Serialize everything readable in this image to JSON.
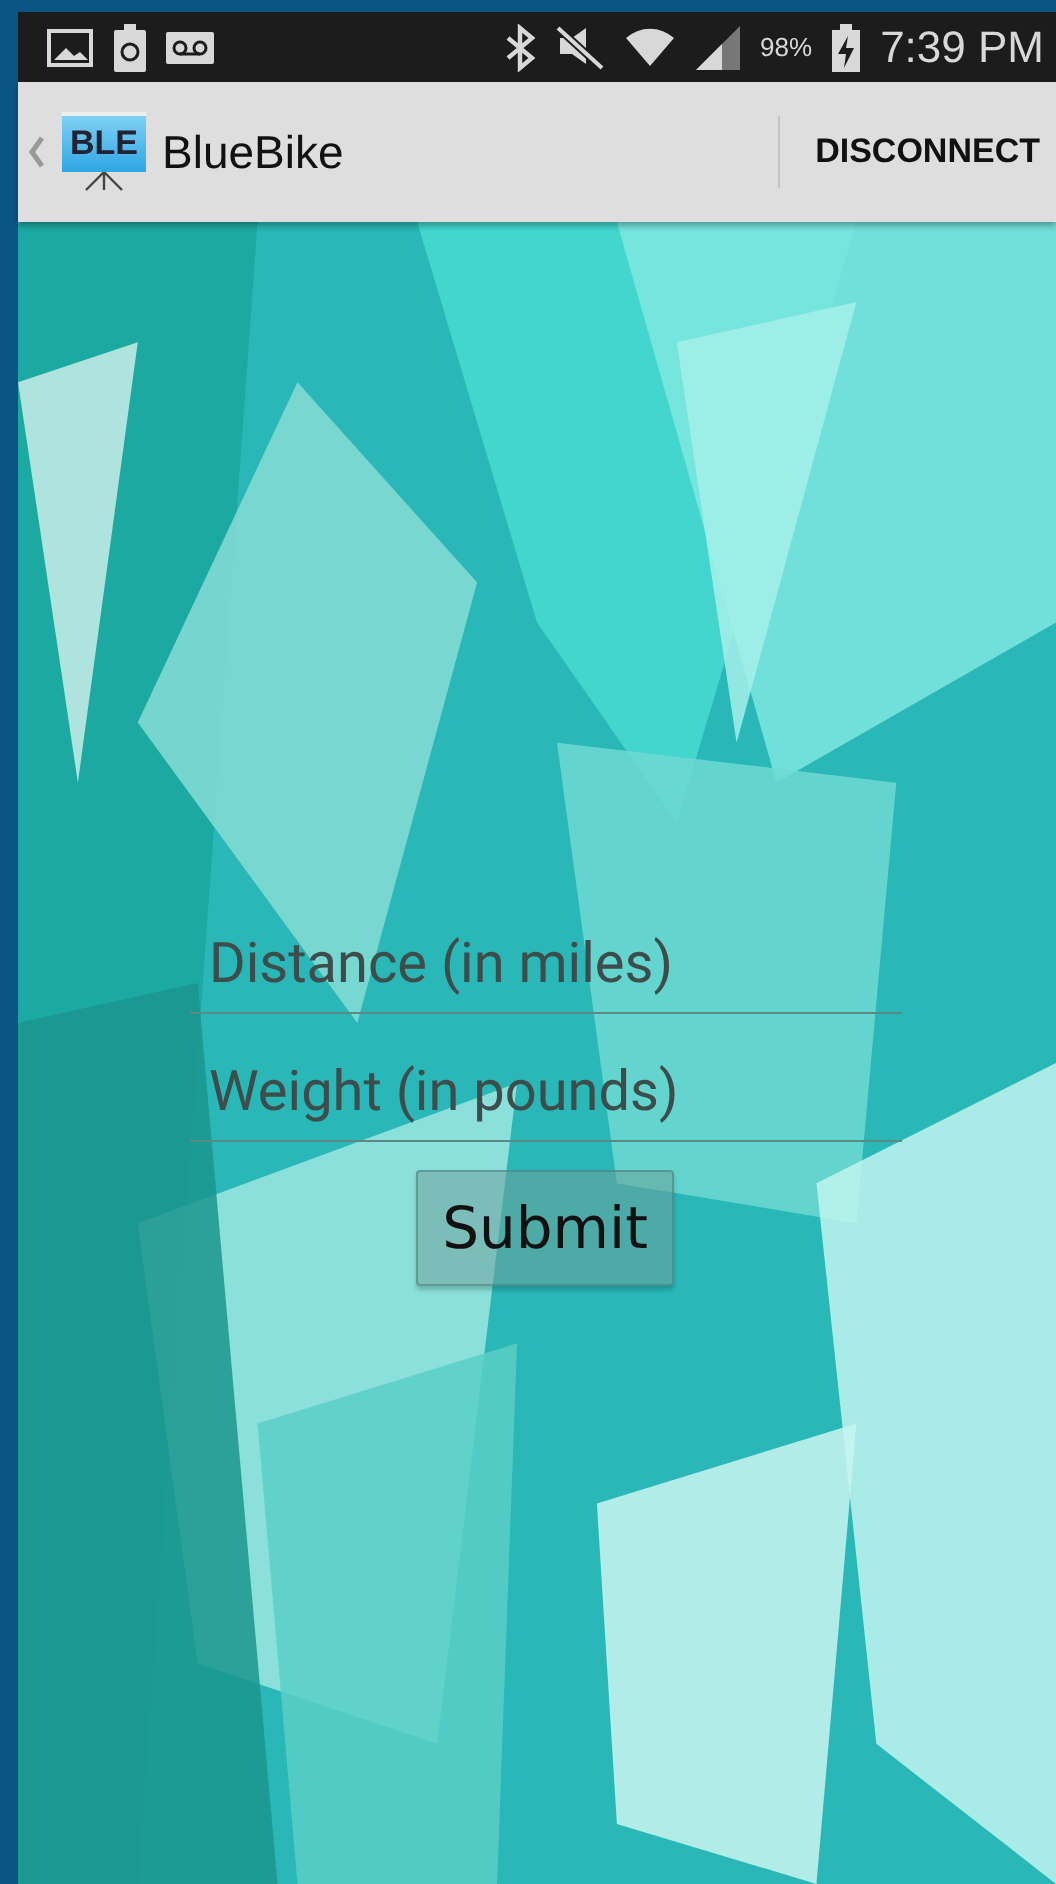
{
  "status_bar": {
    "battery": "98%",
    "time": "7:39 PM"
  },
  "app_bar": {
    "logo_text": "BLE",
    "title": "BlueBike",
    "action": "DISCONNECT"
  },
  "form": {
    "fields": [
      {
        "placeholder": "Distance (in miles)"
      },
      {
        "placeholder": "Weight (in pounds)"
      }
    ],
    "submit": "Submit"
  }
}
